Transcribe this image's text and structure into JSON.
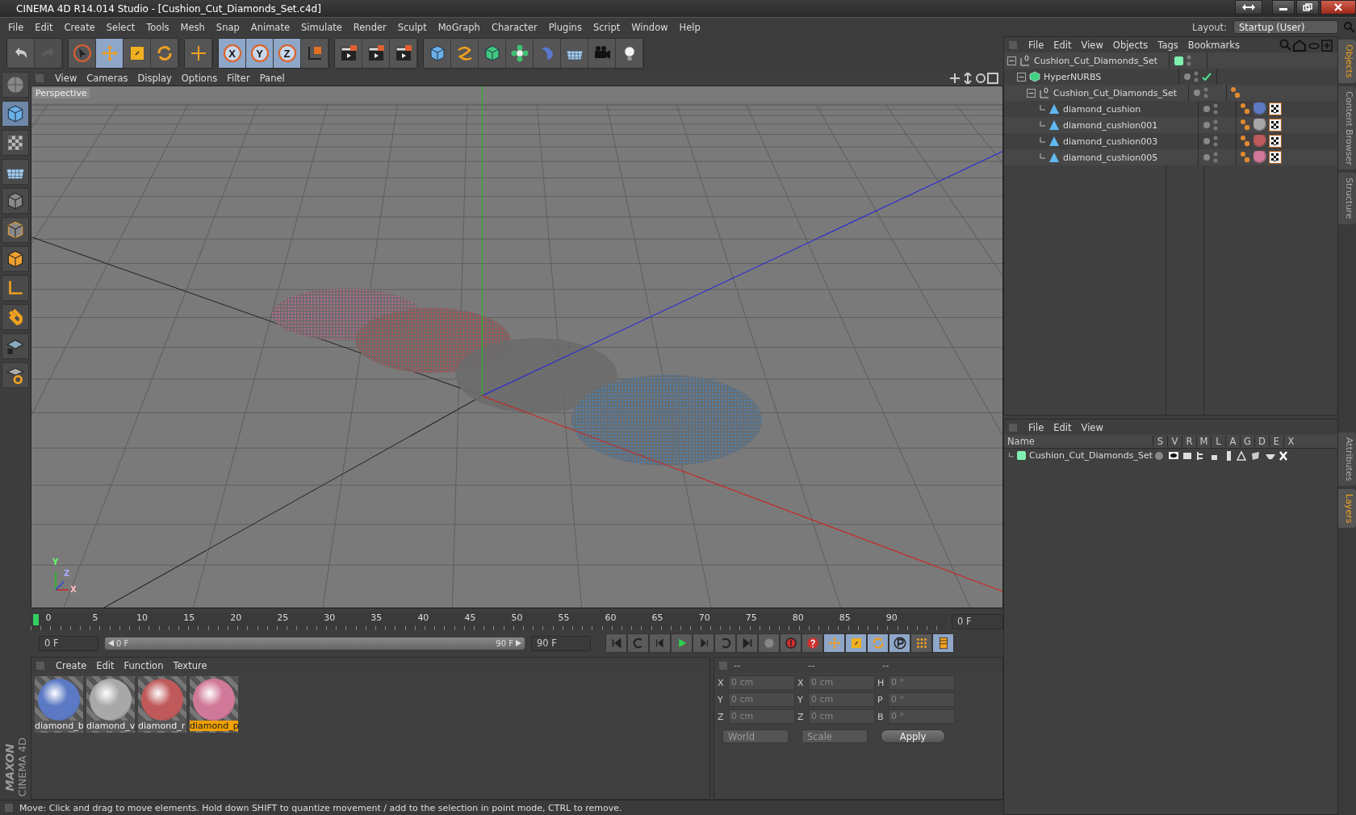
{
  "window": {
    "title": "CINEMA 4D R14.014 Studio - [Cushion_Cut_Diamonds_Set.c4d]"
  },
  "menu": [
    "File",
    "Edit",
    "Create",
    "Select",
    "Tools",
    "Mesh",
    "Snap",
    "Animate",
    "Simulate",
    "Render",
    "Sculpt",
    "MoGraph",
    "Character",
    "Plugins",
    "Script",
    "Window",
    "Help"
  ],
  "layout": {
    "label": "Layout:",
    "value": "Startup (User)"
  },
  "toolbar": [
    [
      {
        "kind": "undo",
        "selected": false,
        "disabled": false
      },
      {
        "kind": "redo",
        "selected": false,
        "disabled": true
      }
    ],
    [
      {
        "kind": "cursor",
        "selected": false,
        "disabled": false
      },
      {
        "kind": "move",
        "selected": true,
        "disabled": false
      },
      {
        "kind": "scale",
        "selected": false,
        "disabled": false
      },
      {
        "kind": "rotate",
        "selected": false,
        "disabled": false
      }
    ],
    [
      {
        "kind": "plus",
        "selected": false,
        "disabled": false
      }
    ],
    [
      {
        "kind": "axis-lock",
        "label": "X",
        "selected": true,
        "disabled": false
      },
      {
        "kind": "axis-lock",
        "label": "Y",
        "selected": true,
        "disabled": false
      },
      {
        "kind": "axis-lock",
        "label": "Z",
        "selected": true,
        "disabled": false
      },
      {
        "kind": "coordinate-system",
        "selected": false,
        "disabled": false
      }
    ],
    [
      {
        "kind": "clapperboard",
        "selected": false,
        "disabled": false
      },
      {
        "kind": "clapperboard",
        "selected": false,
        "disabled": false
      },
      {
        "kind": "clapperboard",
        "selected": false,
        "disabled": false
      }
    ],
    [
      {
        "kind": "cube",
        "selected": false,
        "disabled": false
      },
      {
        "kind": "spline",
        "selected": false,
        "disabled": false
      },
      {
        "kind": "nurbs-cube",
        "selected": false,
        "disabled": false
      },
      {
        "kind": "flower",
        "selected": false,
        "disabled": false
      },
      {
        "kind": "deformer",
        "selected": false,
        "disabled": false
      },
      {
        "kind": "floor",
        "selected": false,
        "disabled": false
      },
      {
        "kind": "camera",
        "selected": false,
        "disabled": false
      },
      {
        "kind": "light-bulb",
        "selected": false,
        "disabled": false
      }
    ]
  ],
  "left_tools": [
    {
      "kind": "sphere",
      "selected": false
    },
    {
      "kind": "cube",
      "selected": true
    },
    {
      "kind": "checker",
      "selected": false
    },
    {
      "kind": "floor",
      "selected": false
    },
    {
      "kind": "points",
      "selected": false
    },
    {
      "kind": "edges",
      "selected": false
    },
    {
      "kind": "polygons",
      "selected": false
    },
    {
      "kind": "axis",
      "selected": false
    },
    {
      "kind": "magnet",
      "selected": false
    },
    {
      "kind": "grid-lock",
      "selected": false
    },
    {
      "kind": "snap",
      "selected": false
    }
  ],
  "viewport": {
    "menu": [
      "View",
      "Cameras",
      "Display",
      "Options",
      "Filter",
      "Panel"
    ],
    "label": "Perspective",
    "axis_labels": [
      "Y",
      "Z",
      "X"
    ]
  },
  "timeline": {
    "ticks": [
      "0",
      "5",
      "10",
      "15",
      "20",
      "25",
      "30",
      "35",
      "40",
      "45",
      "50",
      "55",
      "60",
      "65",
      "70",
      "75",
      "80",
      "85",
      "90"
    ],
    "frame": "0 F",
    "start": "0 F",
    "range": {
      "start": "0 F",
      "end": "90 F",
      "level": 1
    },
    "end": "90 F",
    "buttons": [
      {
        "kind": "first",
        "selected": false
      },
      {
        "kind": "prev-key",
        "selected": false
      },
      {
        "kind": "prev",
        "selected": false
      },
      {
        "kind": "play",
        "selected": false
      },
      {
        "kind": "next",
        "selected": false
      },
      {
        "kind": "next-key",
        "selected": false
      },
      {
        "kind": "last",
        "selected": false
      },
      {
        "kind": "record-off",
        "selected": false
      },
      {
        "kind": "record",
        "selected": false
      },
      {
        "kind": "help",
        "selected": false
      },
      {
        "kind": "move",
        "selected": true
      },
      {
        "kind": "scale",
        "selected": true
      },
      {
        "kind": "rotate",
        "selected": true
      },
      {
        "kind": "param",
        "selected": true
      },
      {
        "kind": "dots",
        "selected": false
      },
      {
        "kind": "film",
        "selected": true
      }
    ]
  },
  "materials": {
    "menu": [
      "Create",
      "Edit",
      "Function",
      "Texture"
    ],
    "items": [
      {
        "name": "diamond_b",
        "color": "#5b79c4",
        "selected": false
      },
      {
        "name": "diamond_v",
        "color": "#a8a8a8",
        "selected": false
      },
      {
        "name": "diamond_r",
        "color": "#c05a5a",
        "selected": false
      },
      {
        "name": "diamond_p",
        "color": "#d07898",
        "selected": true
      }
    ]
  },
  "logo": [
    "MAXON",
    "CINEMA 4D"
  ],
  "coordinates": {
    "headers": [
      "--",
      "--",
      "--"
    ],
    "rows": [
      [
        {
          "label": "X",
          "value": "0 cm"
        },
        {
          "label": "X",
          "value": "0 cm"
        },
        {
          "label": "H",
          "value": "0 °"
        }
      ],
      [
        {
          "label": "Y",
          "value": "0 cm"
        },
        {
          "label": "Y",
          "value": "0 cm"
        },
        {
          "label": "P",
          "value": "0 °"
        }
      ],
      [
        {
          "label": "Z",
          "value": "0 cm"
        },
        {
          "label": "Z",
          "value": "0 cm"
        },
        {
          "label": "B",
          "value": "0 °"
        }
      ]
    ],
    "mode_a": "World",
    "mode_b": "Scale",
    "apply": "Apply"
  },
  "status_bar": "Move: Click and drag to move elements. Hold down SHIFT to quantize movement / add to the selection in point mode, CTRL to remove.",
  "objects": {
    "menu": [
      "File",
      "Edit",
      "View",
      "Objects",
      "Tags",
      "Bookmarks"
    ],
    "tree": [
      {
        "name": "Cushion_Cut_Diamonds_Set",
        "kind": "null",
        "expanded": true,
        "has_layer": true,
        "enabled": false,
        "children": [
          {
            "name": "HyperNURBS",
            "kind": "nurbs",
            "expanded": true,
            "enabled": true,
            "children": [
              {
                "name": "Cushion_Cut_Diamonds_Set",
                "kind": "null",
                "expanded": true,
                "enabled": false,
                "tags": [
                  {
                    "kind": "phong"
                  }
                ],
                "children": [
                  {
                    "name": "diamond_cushion",
                    "kind": "polygon",
                    "enabled": false,
                    "tags": [
                      {
                        "kind": "phong"
                      },
                      {
                        "kind": "material",
                        "color": "#5b79c4"
                      },
                      {
                        "kind": "texture"
                      }
                    ]
                  },
                  {
                    "name": "diamond_cushion001",
                    "kind": "polygon",
                    "enabled": false,
                    "tags": [
                      {
                        "kind": "phong"
                      },
                      {
                        "kind": "material",
                        "color": "#a8a8a8"
                      },
                      {
                        "kind": "texture"
                      }
                    ]
                  },
                  {
                    "name": "diamond_cushion003",
                    "kind": "polygon",
                    "enabled": false,
                    "tags": [
                      {
                        "kind": "phong"
                      },
                      {
                        "kind": "material",
                        "color": "#c05a5a"
                      },
                      {
                        "kind": "texture"
                      }
                    ]
                  },
                  {
                    "name": "diamond_cushion005",
                    "kind": "polygon",
                    "enabled": false,
                    "tags": [
                      {
                        "kind": "phong"
                      },
                      {
                        "kind": "material",
                        "color": "#d07898"
                      },
                      {
                        "kind": "texture"
                      }
                    ]
                  }
                ]
              }
            ]
          }
        ]
      }
    ]
  },
  "layers": {
    "menu": [
      "File",
      "Edit",
      "View"
    ],
    "columns": [
      "Name",
      "S",
      "V",
      "R",
      "M",
      "L",
      "A",
      "G",
      "D",
      "E",
      "X"
    ],
    "rows": [
      {
        "name": "Cushion_Cut_Diamonds_Set",
        "color": "#80f0b0"
      }
    ]
  },
  "side_tabs_top": [
    {
      "label": "Objects",
      "selected": true
    },
    {
      "label": "Content Browser",
      "selected": false
    },
    {
      "label": "Structure",
      "selected": false
    }
  ],
  "side_tabs_bottom": [
    {
      "label": "Attributes",
      "selected": false
    },
    {
      "label": "Layers",
      "selected": true
    }
  ]
}
